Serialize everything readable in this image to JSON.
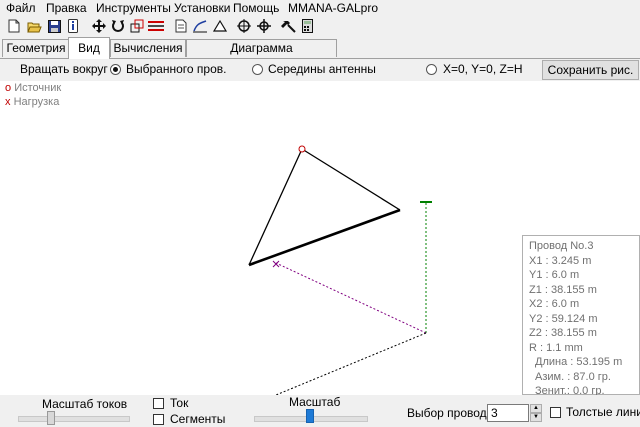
{
  "menu": [
    "Файл",
    "Правка",
    "Инструменты",
    "Установки",
    "Помощь",
    "MMANA-GALpro"
  ],
  "toolbar_icons": [
    "new-file-icon",
    "open-folder-icon",
    "save-icon",
    "info-icon",
    "move-arrows-icon",
    "rotate-icon",
    "scale-icon",
    "wires-icon",
    "document-icon",
    "draw-icon",
    "triangle-icon",
    "target-icon",
    "crosshair-icon",
    "hammer-icon",
    "calculator-icon"
  ],
  "tabs": [
    "Геометрия",
    "Вид",
    "Вычисления",
    "Диаграмма направленности"
  ],
  "active_tab": "Вид",
  "rotate": {
    "label": "Вращать вокруг :",
    "options": [
      "Выбранного пров.",
      "Середины антенны",
      "X=0, Y=0, Z=H"
    ],
    "selected": "Выбранного пров.",
    "save_button": "Сохранить рис."
  },
  "legend": {
    "source_symbol": "o",
    "source_label": "Источник",
    "load_symbol": "x",
    "load_label": "Нагрузка"
  },
  "wire_info": {
    "title": "Провод No.3",
    "lines": [
      "X1   :  3.245 m",
      "Y1   :  6.0 m",
      "Z1   :  38.155 m",
      "X2   :  6.0 m",
      "Y2   :  59.124 m",
      "Z2   :  38.155 m",
      "R    :  1.1 mm",
      "Длина  :  53.195 m",
      "Азим.  :  87.0 гр.",
      "Зенит.:  0.0 гр."
    ]
  },
  "bottom": {
    "current_scale_label": "Масштаб токов",
    "current_checkbox": "Ток",
    "segments_checkbox": "Сегменты",
    "scale_label": "Масштаб",
    "wire_select_label": "Выбор провода",
    "wire_select_value": "3",
    "thick_lines_checkbox": "Толстые линии"
  },
  "colors": {
    "wire": "#000000",
    "axis_z": "#008000",
    "axis_x": "#800080",
    "axis_y": "#000000",
    "source": "#c00000",
    "load": "#c00000",
    "slider_thumb_active": "#1e7ad6"
  }
}
